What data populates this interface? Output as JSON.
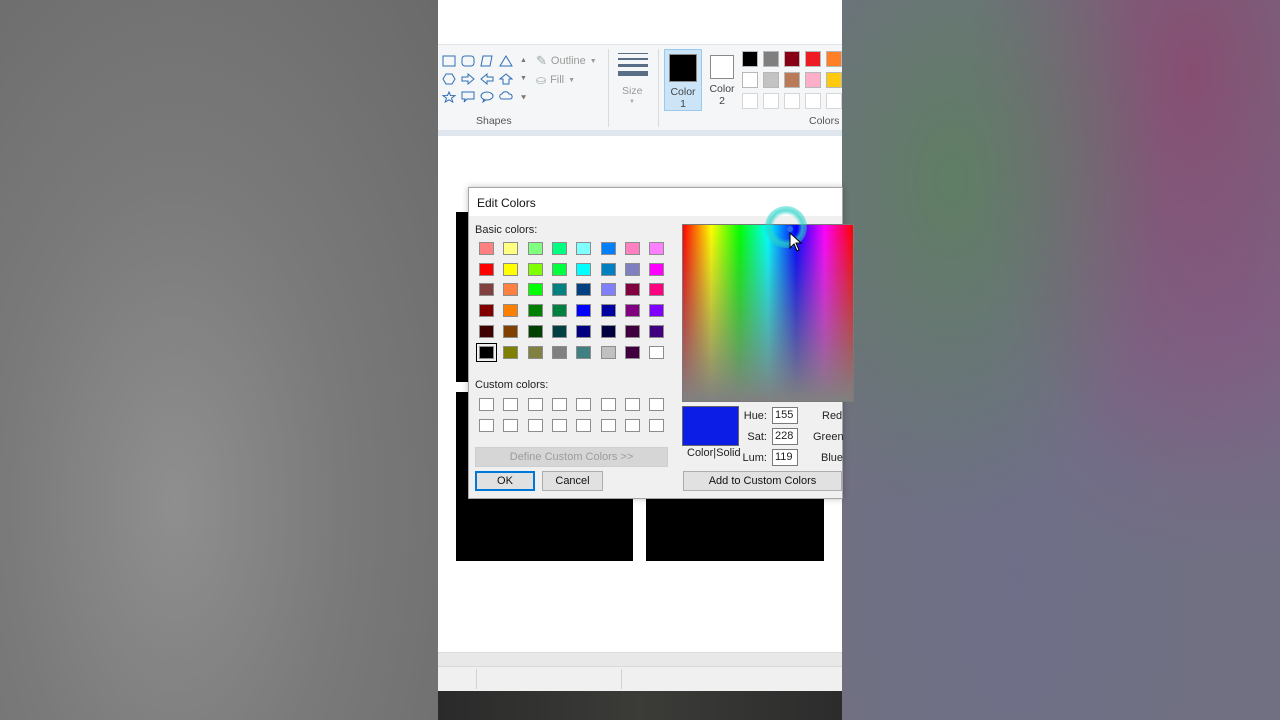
{
  "ribbon": {
    "shapes_label": "Shapes",
    "outline_label": "Outline",
    "fill_label": "Fill",
    "size_label": "Size",
    "color1_label_line1": "Color",
    "color1_label_line2": "1",
    "color2_label_line1": "Color",
    "color2_label_line2": "2",
    "colors_label": "Colors",
    "color1_value": "#000000",
    "color2_value": "#ffffff",
    "palette_row1": [
      "#000000",
      "#7f7f7f",
      "#880015",
      "#ed1c24",
      "#ff7f27"
    ],
    "palette_row2": [
      "#ffffff",
      "#c3c3c3",
      "#b97a57",
      "#ffaec9",
      "#ffc90e"
    ],
    "palette_row3": [
      "#ffffff",
      "#ffffff",
      "#ffffff",
      "#ffffff",
      "#ffffff"
    ]
  },
  "dialog": {
    "title": "Edit Colors",
    "basic_colors_label": "Basic colors:",
    "custom_colors_label": "Custom colors:",
    "define_custom_label": "Define Custom Colors >>",
    "ok_label": "OK",
    "cancel_label": "Cancel",
    "color_solid_label": "Color|Solid",
    "hue_label": "Hue:",
    "sat_label": "Sat:",
    "lum_label": "Lum:",
    "hue_value": "155",
    "sat_value": "228",
    "lum_value": "119",
    "red_label": "Red",
    "green_label": "Green",
    "blue_label": "Blue",
    "add_custom_label": "Add to Custom Colors",
    "preview_color": "#0c1ee6",
    "basic_colors": [
      [
        "#ff8080",
        "#ffff80",
        "#80ff80",
        "#00ff80",
        "#80ffff",
        "#0080ff",
        "#ff80c0",
        "#ff80ff"
      ],
      [
        "#ff0000",
        "#ffff00",
        "#80ff00",
        "#00ff40",
        "#00ffff",
        "#0080c0",
        "#8080c0",
        "#ff00ff"
      ],
      [
        "#804040",
        "#ff8040",
        "#00ff00",
        "#008080",
        "#004080",
        "#8080ff",
        "#800040",
        "#ff0080"
      ],
      [
        "#800000",
        "#ff8000",
        "#008000",
        "#008040",
        "#0000ff",
        "#0000a0",
        "#800080",
        "#8000ff"
      ],
      [
        "#400000",
        "#804000",
        "#004000",
        "#004040",
        "#000080",
        "#000040",
        "#400040",
        "#400080"
      ],
      [
        "#000000",
        "#808000",
        "#808040",
        "#808080",
        "#408080",
        "#c0c0c0",
        "#400040",
        "#ffffff"
      ]
    ]
  }
}
